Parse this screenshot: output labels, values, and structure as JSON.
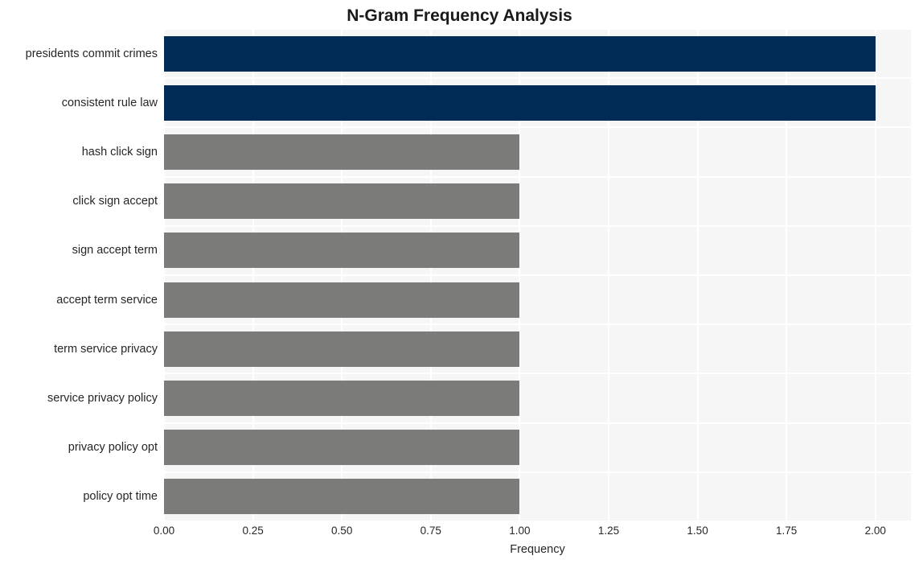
{
  "chart_data": {
    "type": "bar",
    "orientation": "horizontal",
    "title": "N-Gram Frequency Analysis",
    "xlabel": "Frequency",
    "ylabel": "",
    "categories": [
      "presidents commit crimes",
      "consistent rule law",
      "hash click sign",
      "click sign accept",
      "sign accept term",
      "accept term service",
      "term service privacy",
      "service privacy policy",
      "privacy policy opt",
      "policy opt time"
    ],
    "values": [
      2,
      2,
      1,
      1,
      1,
      1,
      1,
      1,
      1,
      1
    ],
    "bar_colors": [
      "#002b55",
      "#002b55",
      "#7b7b79",
      "#7b7b79",
      "#7b7b79",
      "#7b7b79",
      "#7b7b79",
      "#7b7b79",
      "#7b7b79",
      "#7b7b79"
    ],
    "xlim": [
      0,
      2.1
    ],
    "xticks": [
      "0.00",
      "0.25",
      "0.50",
      "0.75",
      "1.00",
      "1.25",
      "1.50",
      "1.75",
      "2.00"
    ],
    "xtick_values": [
      0,
      0.25,
      0.5,
      0.75,
      1.0,
      1.25,
      1.5,
      1.75,
      2.0
    ],
    "grid": true,
    "grid_color": "#ffffff",
    "plot_background": "#f6f6f7",
    "figure_background": "#ffffff",
    "legend": null,
    "legend_position": "none",
    "highlight_color": "#002b55",
    "default_color": "#7b7b79"
  }
}
